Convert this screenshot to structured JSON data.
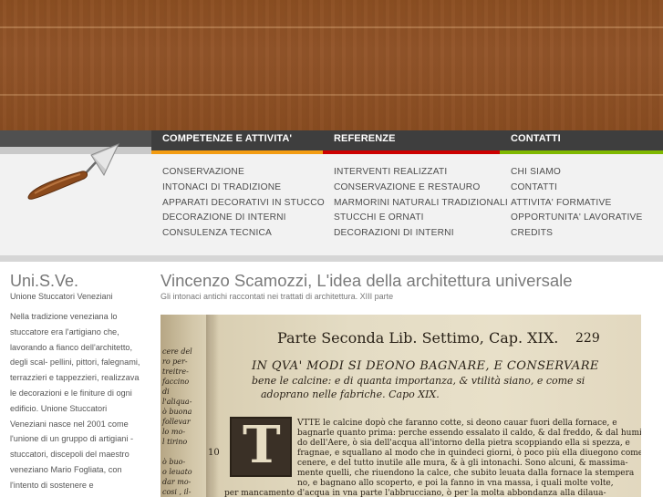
{
  "nav": {
    "tabs": [
      {
        "label": "COMPETENZE E ATTIVITA'",
        "color": "#f39c12"
      },
      {
        "label": "REFERENZE",
        "color": "#cc0000"
      },
      {
        "label": "CONTATTI",
        "color": "#7fb800"
      }
    ],
    "competenze": [
      "CONSERVAZIONE",
      "INTONACI DI TRADIZIONE",
      "APPARATI DECORATIVI IN STUCCO",
      "DECORAZIONE DI INTERNI",
      "CONSULENZA TECNICA"
    ],
    "referenze": [
      "INTERVENTI REALIZZATI",
      "CONSERVAZIONE E RESTAURO",
      "MARMORINI NATURALI TRADIZIONALI",
      "STUCCHI E ORNATI",
      "DECORAZIONI DI INTERNI"
    ],
    "contatti": [
      "CHI SIAMO",
      "CONTATTI",
      "ATTIVITA' FORMATIVE",
      "OPPORTUNITA' LAVORATIVE",
      "CREDITS"
    ]
  },
  "logo": {
    "icon": "trowel-icon"
  },
  "sidebar": {
    "title": "Uni.S.Ve.",
    "subtitle": "Unione Stuccatori Veneziani",
    "body": "Nella tradizione veneziana lo stuccatore era l'artigiano che, lavorando a fianco dell'architetto, degli scal- pellini, pittori, falegnami, terrazzieri e tappezzieri, realizzava le decorazioni e le finiture di ogni edificio. Unione Stuccatori Veneziani nasce nel 2001 come l'unione di un gruppo di artigiani - stuccatori, discepoli del maestro veneziano Mario Fogliata, con l'intento di sostenere e"
  },
  "article": {
    "title": "Vincenzo Scamozzi, L'idea della architettura universale",
    "subtitle": "Gli intonaci antichi raccontati nei trattati di architettura. XIII parte"
  },
  "book": {
    "header": "Parte Seconda Lib. Settimo, Cap. XIX.",
    "page_number": "229",
    "heading1": "IN QVA' MODI SI DEONO BAGNARE, E CONSERVARE",
    "heading2": "bene le calcine: e di quanta importanza, & vtilità siano, e come si",
    "heading3": "adoprano nelle fabriche.   Capo XIX.",
    "lines": [
      "VTTE le calcine dopò che faranno cotte, si deono cauar fuori della fornace, e",
      "bagnarle quanto prima: perche essendo essalato il caldo, & dal freddo, & dal humi-",
      "do dell'Aere, ò sia dell'acqua all'intorno della pietra scoppiando ella si spezza, e",
      "fragnae, e squallano al modo che in quindeci giorni, ò poco più ella diuegono come",
      "cenere, e del tutto inutile alle mura, & à gli intonachi.  Sono alcuni, & massima-",
      "mente quelli, che riuendono la calce, che subito leuata dalla fornace la stempera",
      "no, e bagnano allo scoperto, e poi la fanno in vna massa, i quali molte volte,",
      "per mancamento d'acqua in vna parte l'abbrucciano, ò per la molta abbondanza alla dilaua-"
    ],
    "margin_notes": [
      "cere del",
      "ro per-",
      "treitre-",
      "faccino",
      "di",
      "l'aliqua-",
      "ò buona",
      "follevar",
      "lo mo-",
      "l tirino",
      "ò buo-",
      "o leuato",
      "dar mo-",
      "cosi , il-"
    ],
    "margin_number": "10",
    "initial": "T"
  }
}
